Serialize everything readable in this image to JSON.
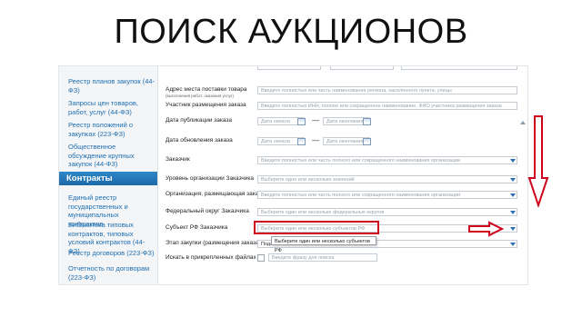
{
  "slide": {
    "title": "ПОИСК АУКЦИОНОВ"
  },
  "sidebar": {
    "links_top": [
      "Реестр планов закупок (44-ФЗ)",
      "Запросы цен товаров, работ, услуг (44-ФЗ)",
      "Реестр положений о закупках (223-ФЗ)",
      "Общественное обсуждение крупных закупок (44-ФЗ)"
    ],
    "section_title": "Контракты",
    "links_bottom": [
      "Единый реестр государственных и муниципальных контрактов",
      "Библиотека типовых контрактов, типовых условий контрактов (44-ФЗ)",
      "Реестр договоров (223-ФЗ)",
      "Отчетность по договорам (223-ФЗ)"
    ]
  },
  "form": {
    "top_cut": "",
    "delivery_place": {
      "label": "Адрес места поставки товара",
      "hint": "(выполнения работ, оказания услуг)",
      "placeholder": "Введите полностью или часть наименования региона, населенного пункта, улицы"
    },
    "participant": {
      "label": "Участник размещения заказа",
      "placeholder": "Введите полностью ИНН, полное или сокращенное наименование, ФИО участника размещения заказа"
    },
    "publication_date": {
      "label": "Дата публикации заказа",
      "from_placeholder": "Дата начала",
      "to_placeholder": "Дата окончания"
    },
    "update_date": {
      "label": "Дата обновления заказа",
      "from_placeholder": "Дата начала",
      "to_placeholder": "Дата окончания"
    },
    "customer": {
      "label": "Заказчик",
      "placeholder": "Введите полностью или часть полного или сокращенного наименования организации"
    },
    "customer_level": {
      "label": "Уровень организации Заказчика",
      "placeholder": "Выберите одно или несколько значений"
    },
    "placing_org": {
      "label": "Организация, размещающая заказ",
      "placeholder": "Введите полностью или часть полного или сокращенного наименования организации"
    },
    "federal_district": {
      "label": "Федеральный округ Заказчика",
      "placeholder": "Выберите один или несколько федеральных округов"
    },
    "subject_rf": {
      "label": "Субъект РФ Заказчика",
      "placeholder": "Выберите один или несколько субъектов РФ",
      "tooltip": "Выберите один или несколько субъектов РФ"
    },
    "purchase_stage": {
      "label": "Этап закупки (размещения заказа)",
      "value": "Пода"
    },
    "attached_files": {
      "label": "Искать в прикрепленных файлах",
      "placeholder": "Введите фразу для поиска"
    }
  },
  "colors": {
    "link": "#1f6fb2",
    "section_header": "#1d6aa8",
    "annotation": "#d0021b",
    "dropdown_arrow": "#2c6db1"
  }
}
